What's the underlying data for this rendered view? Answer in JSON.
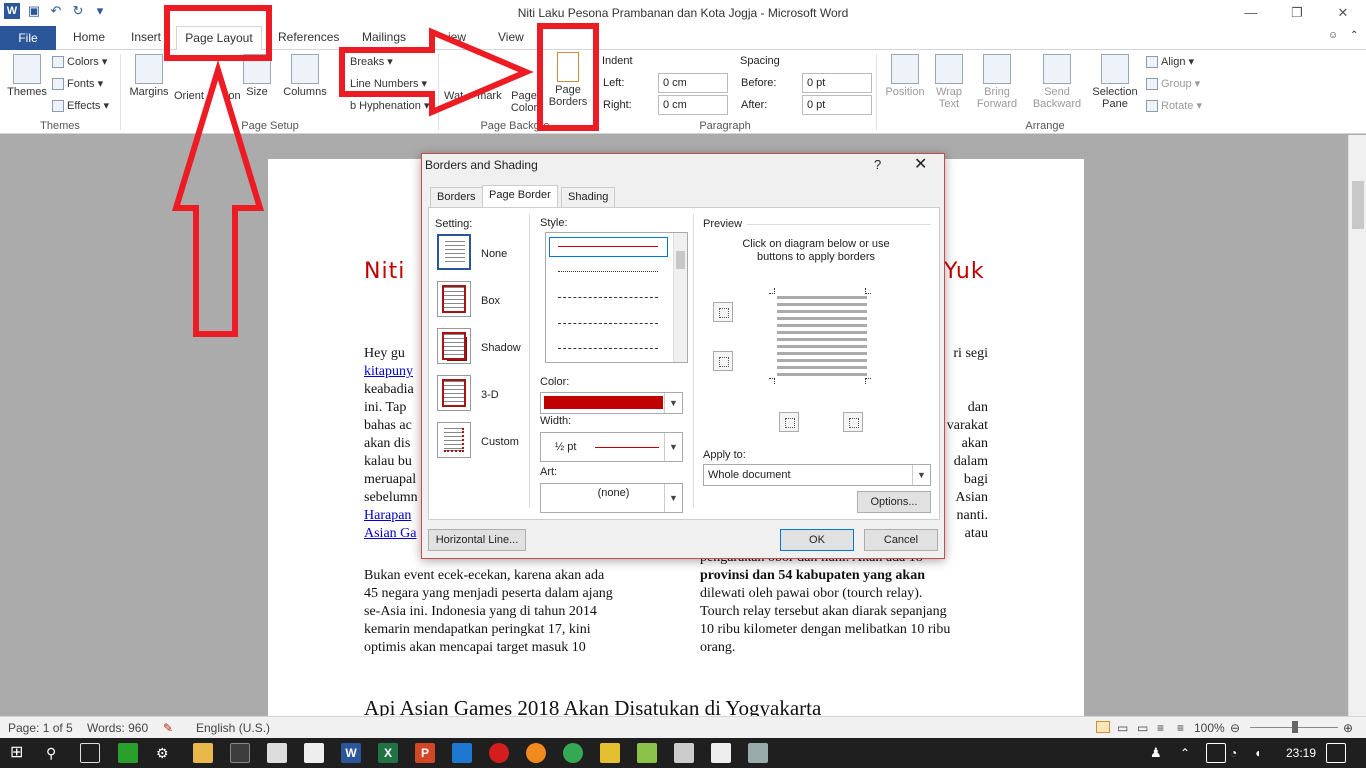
{
  "window": {
    "title": "Niti Laku Pesona Prambanan dan Kota Jogja  -  Microsoft Word",
    "help_glyph": "?",
    "minimize": "—",
    "restore": "❐",
    "close": "✕"
  },
  "tabs": {
    "file": "File",
    "home": "Home",
    "insert": "Insert",
    "page_layout": "Page Layout",
    "references": "References",
    "mailings": "Mailings",
    "review": "iew",
    "view": "View"
  },
  "ribbon": {
    "themes": "Themes",
    "colors": "Colors",
    "fonts": "Fonts",
    "effects": "Effects",
    "themes_group": "Themes",
    "margins": "Margins",
    "orientation": "Orient",
    "orientation_end": "ion",
    "size": "Size",
    "columns": "Columns",
    "breaks": "Breaks",
    "line_numbers": "Line Numbers",
    "hyphenation": "Hyphenation",
    "page_setup_group": "Page Setup",
    "watermark": "Wat",
    "watermark_end": "mark",
    "page_color": "Page",
    "page_color_2": "Color",
    "page_borders": "Page",
    "page_borders_2": "Borders",
    "page_background_group": "Page Backgro",
    "indent": "Indent",
    "left": "Left:",
    "right": "Right:",
    "indent_left_val": "0 cm",
    "indent_right_val": "0 cm",
    "spacing": "Spacing",
    "before": "Before:",
    "after": "After:",
    "before_val": "0 pt",
    "after_val": "0 pt",
    "paragraph_group": "Paragraph",
    "position": "Position",
    "wrap_text": "Wrap",
    "wrap_text_2": "Text",
    "bring_forward": "Bring",
    "bring_forward_2": "Forward",
    "send_backward": "Send",
    "send_backward_2": "Backward",
    "selection_pane": "Selection",
    "selection_pane_2": "Pane",
    "align": "Align",
    "group": "Group",
    "rotate": "Rotate",
    "arrange_group": "Arrange"
  },
  "document": {
    "heading_left": "Niti",
    "heading_right": "Yuk",
    "para1_left": [
      "Hey  gu",
      "kitapuny",
      "keabadia",
      "ini.  Tap",
      "bahas  ac",
      "akan  dis",
      "kalau  bu",
      "meruapal",
      "sebelumn",
      "Harapan",
      "Asian  Ga"
    ],
    "para1_right": [
      "ri  segi",
      "",
      "",
      "dan",
      "varakat",
      "akan",
      "dalam",
      "bagi",
      "Asian",
      "nanti.",
      "atau"
    ],
    "para2_left": [
      "Bukan  event  ecek-ecekan,  karena  akan  ada",
      "45  negara  yang  menjadi  peserta  dalam  ajang",
      "se-Asia  ini.  Indonesia  yang  di  tahun  2014",
      "kemarin    mendapatkan    peringkat    17,    kini",
      "optimis    akan    mencapai    target    masuk    10"
    ],
    "para2_right": [
      "pengarakan obor dan ilahi. Akan ada 18",
      "provinsi  dan  54  kabupaten  yang  akan",
      "dilewati  oleh  pawai  obor  (tourch  relay).",
      "Tourch relay tersebut akan diarak sepanjang",
      "10 ribu kilometer dengan melibatkan 10 ribu",
      "orang."
    ],
    "heading2": "Api Asian Games 2018 Akan Disatukan di Yogyakarta"
  },
  "status": {
    "page": "Page: 1 of 5",
    "words": "Words: 960",
    "language": "English (U.S.)",
    "zoom": "100%"
  },
  "taskbar": {
    "time": "23:19"
  },
  "dialog": {
    "title": "Borders and Shading",
    "help": "?",
    "close": "✕",
    "tab_borders": "Borders",
    "tab_page_border": "Page Border",
    "tab_shading": "Shading",
    "setting_label": "Setting:",
    "settings": [
      "None",
      "Box",
      "Shadow",
      "3-D",
      "Custom"
    ],
    "style_label": "Style:",
    "color_label": "Color:",
    "color_value": "#c00000",
    "width_label": "Width:",
    "width_value": "½ pt",
    "art_label": "Art:",
    "art_value": "(none)",
    "preview_label": "Preview",
    "preview_hint_1": "Click on diagram below or use",
    "preview_hint_2": "buttons to apply borders",
    "apply_to_label": "Apply to:",
    "apply_to_value": "Whole document",
    "options": "Options...",
    "horizontal_line": "Horizontal Line...",
    "ok": "OK",
    "cancel": "Cancel"
  }
}
